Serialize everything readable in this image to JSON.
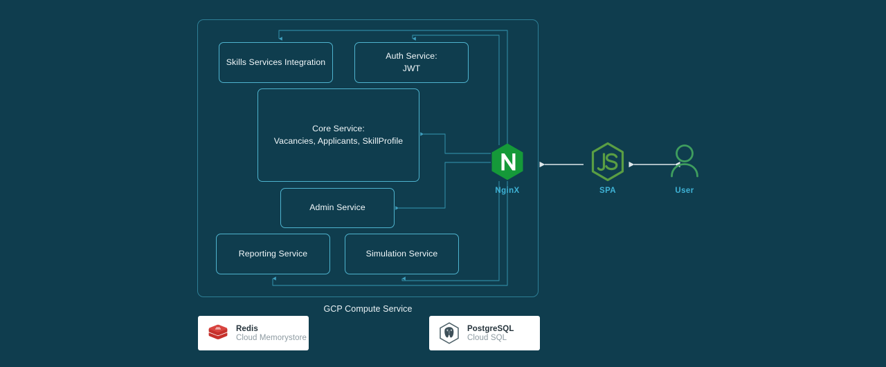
{
  "theme": {
    "page_background": "#0f3d4e",
    "container_border": "#2e7f96",
    "service_border": "#4fb4cf",
    "accent_cyan": "#3fb3d6",
    "nginx_green": "#159939",
    "node_green": "#5a9e43",
    "user_green": "#3f9e5e",
    "redis_red": "#c6302b",
    "card_white": "#ffffff",
    "arrow_white": "#dfe8ec"
  },
  "diagram": {
    "title": "GCP Compute Service",
    "container_label": "GCP Compute Service",
    "services": [
      {
        "id": "skills",
        "label": "Skills Services Integration"
      },
      {
        "id": "auth",
        "label": "Auth Service:\nJWT",
        "line1": "Auth Service:",
        "line2": "JWT"
      },
      {
        "id": "core",
        "label": "Core Service:\nVacancies, Applicants, SkillProfile",
        "line1": "Core Service:",
        "line2": "Vacancies, Applicants, SkillProfile"
      },
      {
        "id": "admin",
        "label": "Admin Service"
      },
      {
        "id": "reporting",
        "label": "Reporting Service"
      },
      {
        "id": "simulation",
        "label": "Simulation Service"
      }
    ],
    "nodes": [
      {
        "id": "nginx",
        "caption": "NginX",
        "icon": "nginx-logo-icon"
      },
      {
        "id": "spa",
        "caption": "SPA",
        "icon": "nodejs-logo-icon"
      },
      {
        "id": "user",
        "caption": "User",
        "icon": "user-person-icon"
      }
    ],
    "connectors": [
      {
        "id": "nginx-to-spa",
        "direction": "left",
        "from": "spa",
        "to": "nginx"
      },
      {
        "id": "spa-to-user",
        "direction": "both",
        "from": "spa",
        "to": "user"
      }
    ],
    "datastores": [
      {
        "id": "redis",
        "name": "Redis",
        "subtitle": "Cloud Memorystore",
        "icon": "redis-logo-icon"
      },
      {
        "id": "postgresql",
        "name": "PostgreSQL",
        "subtitle": "Cloud SQL",
        "icon": "postgresql-logo-icon"
      }
    ]
  }
}
